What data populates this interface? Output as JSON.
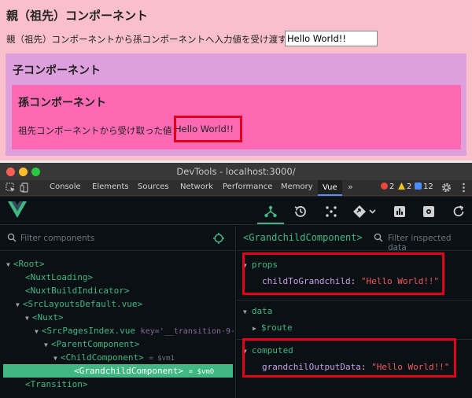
{
  "app": {
    "parent_title": "親（祖先）コンポーネント",
    "parent_label": "親（祖先）コンポーネントから孫コンポーネントへ入力値を受け渡す：",
    "parent_input_value": "Hello World!!",
    "child_title": "子コンポーネント",
    "grandchild_title": "孫コンポーネント",
    "grandchild_label": "祖先コンポーネントから受け取った値：",
    "grandchild_value": "Hello World!!"
  },
  "devtools": {
    "window_title": "DevTools - localhost:3000/",
    "tabs": [
      "Console",
      "Elements",
      "Sources",
      "Network",
      "Performance",
      "Memory",
      "Vue"
    ],
    "more_tabs": "»",
    "error_count": "2",
    "warning_count": "2",
    "message_count": "12"
  },
  "vue": {
    "filter_components_placeholder": "Filter components",
    "filter_inspected_placeholder": "Filter inspected data",
    "tree": [
      {
        "label": "<Root>",
        "attr": "",
        "vm": ""
      },
      {
        "label": "<NuxtLoading>",
        "attr": "",
        "vm": ""
      },
      {
        "label": "<NuxtBuildIndicator>",
        "attr": "",
        "vm": ""
      },
      {
        "label": "<SrcLayoutsDefault.vue>",
        "attr": "",
        "vm": ""
      },
      {
        "label": "<Nuxt>",
        "attr": "",
        "vm": ""
      },
      {
        "label": "<SrcPagesIndex.vue",
        "attr": "key='__transition-9-",
        "vm": ""
      },
      {
        "label": "<ParentComponent>",
        "attr": "",
        "vm": ""
      },
      {
        "label": "<ChildComponent>",
        "attr": "",
        "vm": "= $vm1"
      },
      {
        "label": "<GrandchildComponent>",
        "attr": "",
        "vm": "= $vm0"
      },
      {
        "label": "<Transition>",
        "attr": "",
        "vm": ""
      }
    ],
    "inspected_component": "<GrandchildComponent>",
    "sections": {
      "props": "props",
      "data": "data",
      "computed": "computed"
    },
    "props_key": "childToGrandchild",
    "props_value": "\"Hello World!!\"",
    "data_route": "$route",
    "computed_key": "grandchilOutputData",
    "computed_value": "\"Hello World!!\""
  },
  "colors": {
    "parent_bg": "#f9c0cb",
    "child_bg": "#dda0dd",
    "grandchild_bg": "#ff69b4",
    "highlight": "#e2001a",
    "vue_green": "#42b883"
  }
}
